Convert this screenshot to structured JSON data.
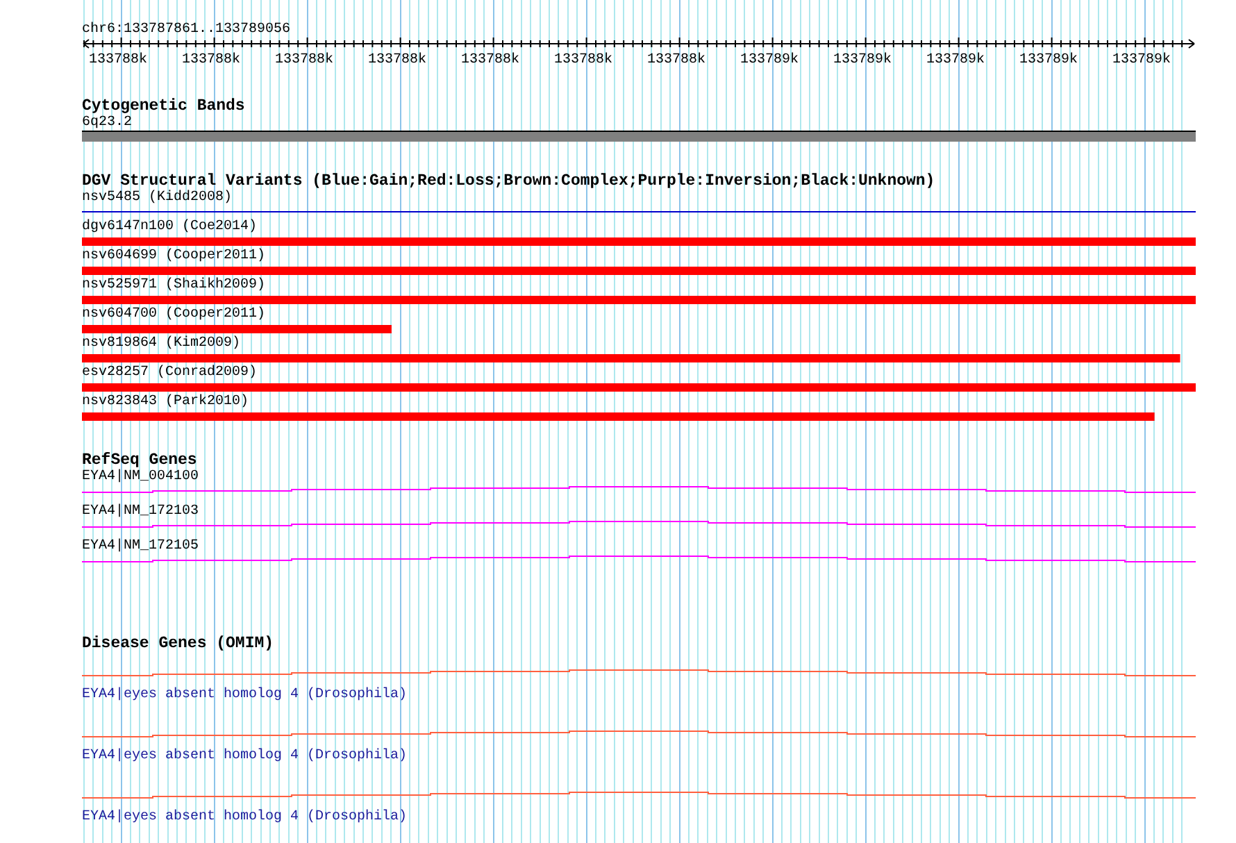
{
  "region": "chr6:133787861..133789056",
  "ruler": {
    "ticks": [
      "133788k",
      "133788k",
      "133788k",
      "133788k",
      "133788k",
      "133788k",
      "133788k",
      "133789k",
      "133789k",
      "133789k",
      "133789k",
      "133789k"
    ]
  },
  "tracks": [
    {
      "kind": "cytoband",
      "title": "Cytogenetic Bands",
      "features": [
        {
          "label": "6q23.2"
        }
      ]
    },
    {
      "kind": "variants",
      "title": "DGV Structural Variants (Blue:Gain;Red:Loss;Brown:Complex;Purple:Inversion;Black:Unknown)",
      "features": [
        {
          "label": "nsv5485 (Kidd2008)",
          "kind": "line",
          "color": "#0000cc",
          "level": 1
        },
        {
          "label": "dgv6147n100 (Coe2014)",
          "kind": "bar",
          "color": "#ff0000",
          "level": 1
        },
        {
          "label": "nsv604699 (Cooper2011)",
          "kind": "bar",
          "color": "#ff0000",
          "level": 1
        },
        {
          "label": "nsv525971 (Shaikh2009)",
          "kind": "bar",
          "color": "#ff0000",
          "level": 1
        },
        {
          "label": "nsv604700 (Cooper2011)",
          "kind": "bar",
          "color": "#ff0000",
          "level": 0.278
        },
        {
          "label": "nsv819864 (Kim2009)",
          "kind": "bar",
          "color": "#ff0000",
          "level": 0.986
        },
        {
          "label": "esv28257 (Conrad2009)",
          "kind": "bar",
          "color": "#ff0000",
          "level": 1
        },
        {
          "label": "nsv823843 (Park2010)",
          "kind": "bar",
          "color": "#ff0000",
          "level": 0.963
        }
      ]
    },
    {
      "kind": "genes",
      "title": "RefSeq Genes",
      "features": [
        {
          "label": "EYA4|NM_004100"
        },
        {
          "label": "EYA4|NM_172103"
        },
        {
          "label": "EYA4|NM_172105"
        }
      ]
    },
    {
      "kind": "disease",
      "title": "Disease Genes (OMIM)",
      "features": [
        {
          "label": "EYA4|eyes absent homolog 4 (Drosophila)"
        },
        {
          "label": "EYA4|eyes absent homolog 4 (Drosophila)"
        },
        {
          "label": "EYA4|eyes absent homolog 4 (Drosophila)"
        }
      ]
    }
  ]
}
